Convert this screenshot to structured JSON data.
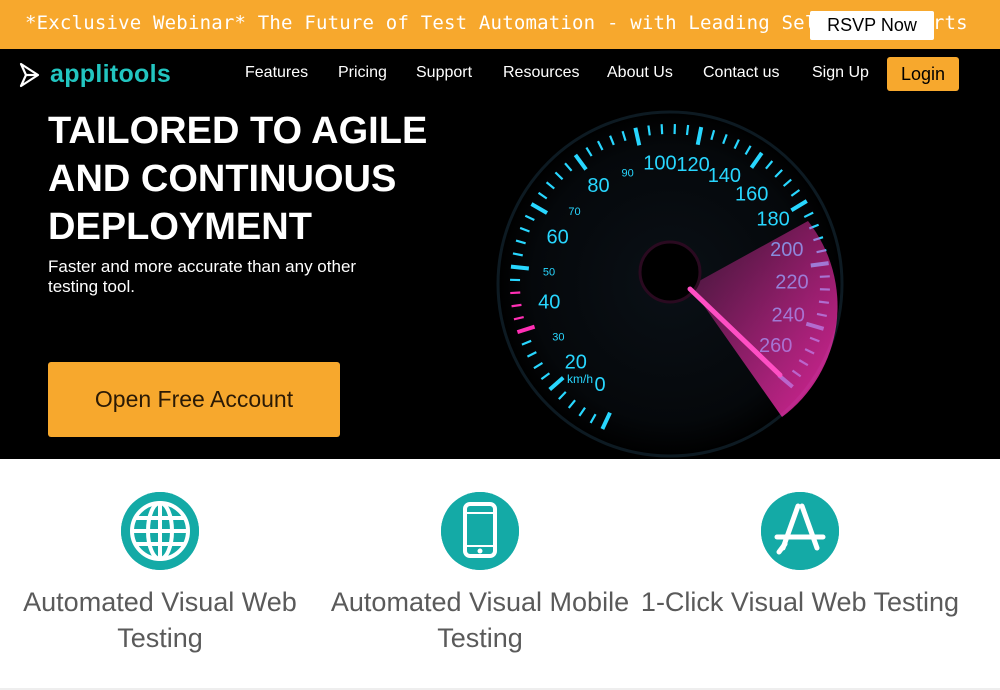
{
  "banner": {
    "text": "*Exclusive Webinar* The Future of Test Automation - with Leading Selenium Experts",
    "cta": "RSVP Now"
  },
  "brand": {
    "name": "applitools",
    "color": "#22c5c0"
  },
  "nav": {
    "items": [
      "Features",
      "Pricing",
      "Support",
      "Resources",
      "About Us",
      "Contact us",
      "Sign Up"
    ],
    "login": "Login"
  },
  "hero": {
    "title_lines": [
      "TAILORED TO AGILE",
      "AND CONTINUOUS",
      "DEPLOYMENT"
    ],
    "subtitle": "Faster and more accurate than any other testing tool.",
    "cta": "Open Free Account"
  },
  "speedometer": {
    "unit": "km/h",
    "left_labels": [
      "0",
      "20",
      "30",
      "40",
      "50",
      "60",
      "70",
      "80",
      "90"
    ],
    "right_labels": [
      "100",
      "120",
      "140",
      "160",
      "180",
      "200",
      "220",
      "240",
      "260"
    ],
    "tick_color": "#28d7ff",
    "needle_color": "#ff2fb4"
  },
  "features": [
    {
      "title": "Automated Visual Web Testing",
      "icon": "globe-icon"
    },
    {
      "title": "Automated Visual Mobile Testing",
      "icon": "mobile-icon"
    },
    {
      "title": "1-Click Visual Web Testing",
      "icon": "app-store-icon"
    }
  ],
  "colors": {
    "accent": "#f7a82d",
    "teal": "#14aaa6"
  }
}
